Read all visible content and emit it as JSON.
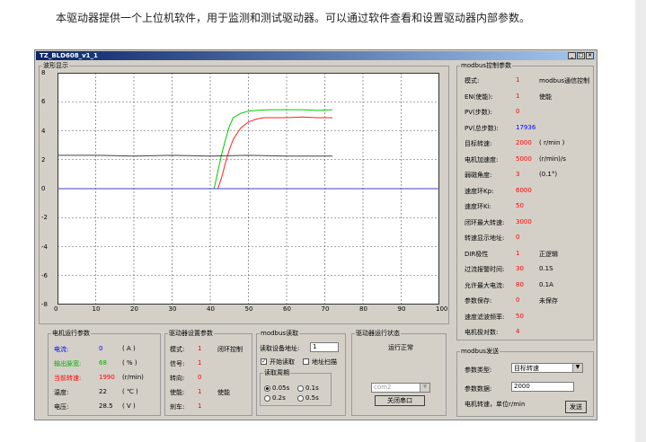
{
  "intro": "本驱动器提供一个上位机软件，用于监测和测试驱动器。可以通过软件查看和设置驱动器内部参数。",
  "window": {
    "title": "TZ_BLD608_v1_1"
  },
  "wave": {
    "legend": "波形显示",
    "chart_data": {
      "type": "line",
      "xlim": [
        0,
        100
      ],
      "ylim": [
        -8,
        8
      ],
      "x_ticks": [
        "0",
        "10",
        "20",
        "30",
        "40",
        "50",
        "60",
        "70",
        "80",
        "90",
        "100"
      ],
      "y_ticks": [
        "8",
        "6",
        "4",
        "2",
        "0",
        "-2",
        "-4",
        "-6",
        "-8"
      ],
      "grid": true,
      "series": [
        {
          "color": "#00cc00",
          "x": [
            0,
            40,
            41,
            42,
            43,
            44,
            45,
            46,
            48,
            50,
            52,
            56,
            60,
            64,
            68,
            72
          ],
          "y": [
            null,
            null,
            0,
            1.2,
            2.4,
            3.4,
            4.3,
            4.9,
            5.2,
            5.35,
            5.4,
            5.45,
            5.45,
            5.45,
            5.4,
            5.45
          ]
        },
        {
          "color": "#ff2020",
          "x": [
            0,
            41,
            42,
            43,
            44,
            45,
            46,
            48,
            50,
            52,
            54,
            56,
            60,
            64,
            68,
            72
          ],
          "y": [
            null,
            null,
            0,
            0.8,
            1.8,
            2.7,
            3.4,
            4.2,
            4.6,
            4.8,
            4.9,
            4.9,
            4.9,
            4.95,
            4.9,
            4.9
          ]
        },
        {
          "color": "#404040",
          "x": [
            0,
            10,
            20,
            30,
            40,
            50,
            60,
            72
          ],
          "y": [
            2.3,
            2.3,
            2.25,
            2.3,
            2.25,
            2.3,
            2.25,
            2.25
          ]
        },
        {
          "color": "#4040c0",
          "x": [
            0,
            100
          ],
          "y": [
            0,
            0
          ]
        }
      ]
    }
  },
  "motor": {
    "legend": "电机运行参数",
    "rows": [
      {
        "label": "电流:",
        "value": "0",
        "unit": "( A )",
        "color": "#0000ff"
      },
      {
        "label": "输出脉宽:",
        "value": "68",
        "unit": "( % )",
        "color": "#00b000"
      },
      {
        "label": "当前转速:",
        "value": "1990",
        "unit": "(r/min)",
        "color": "#ff0000"
      },
      {
        "label": "温度:",
        "value": "22",
        "unit": "( ℃ )",
        "color": "#000000"
      },
      {
        "label": "电压:",
        "value": "28.5",
        "unit": "( V )",
        "color": "#000000"
      }
    ]
  },
  "driver": {
    "legend": "驱动器设置参数",
    "rows": [
      {
        "label": "模式:",
        "value": "1",
        "note": "闭环控制"
      },
      {
        "label": "信号:",
        "value": "1",
        "note": ""
      },
      {
        "label": "转向:",
        "value": "0",
        "note": ""
      },
      {
        "label": "使能:",
        "value": "1",
        "note": "使能"
      },
      {
        "label": "刹车:",
        "value": "1",
        "note": ""
      }
    ]
  },
  "mbread": {
    "legend": "modbus读取",
    "addr_label": "读取设备地址:",
    "addr_value": "1",
    "start_label": "开始读取",
    "scan_label": "地址扫描",
    "period_legend": "读取周期",
    "periods": [
      "0.05s",
      "0.1s",
      "0.2s",
      "0.5s"
    ]
  },
  "status": {
    "legend": "驱动器运行状态",
    "text": "运行正常",
    "port": "com2",
    "close_btn": "关闭串口"
  },
  "ctrl": {
    "legend": "modbus控制参数",
    "rows": [
      {
        "label": "模式:",
        "value": "1",
        "note": "modbus通信控制",
        "color": "#ff0000"
      },
      {
        "label": "EN(使能):",
        "value": "1",
        "note": "使能",
        "color": "#ff0000"
      },
      {
        "label": "PV(步数):",
        "value": "0",
        "note": "",
        "color": "#ff0000"
      },
      {
        "label": "PV(总步数):",
        "value": "17936",
        "note": "",
        "color": "#0000ff"
      },
      {
        "label": "目标转速:",
        "value": "2000",
        "note": "( r/min )",
        "color": "#ff0000"
      },
      {
        "label": "电机加速度:",
        "value": "5000",
        "note": "(r/min)/s",
        "color": "#ff0000"
      },
      {
        "label": "弱磁角度:",
        "value": "3",
        "note": "(0.1°)",
        "color": "#ff0000"
      },
      {
        "label": "速度环Kp:",
        "value": "6000",
        "note": "",
        "color": "#ff0000"
      },
      {
        "label": "速度环Ki:",
        "value": "50",
        "note": "",
        "color": "#ff0000"
      },
      {
        "label": "闭环最大转速:",
        "value": "3000",
        "note": "",
        "color": "#ff0000"
      },
      {
        "label": "转速显示地址:",
        "value": "0",
        "note": "",
        "color": "#ff0000"
      },
      {
        "label": "DIR极性",
        "value": "1",
        "note": "正逻辑",
        "color": "#ff0000"
      },
      {
        "label": "过流报警时间:",
        "value": "30",
        "note": "0.1S",
        "color": "#ff0000"
      },
      {
        "label": "允许最大电流:",
        "value": "80",
        "note": "0.1A",
        "color": "#ff0000"
      },
      {
        "label": "参数保存:",
        "value": "0",
        "note": "未保存",
        "color": "#ff0000"
      },
      {
        "label": "速度滤波频率:",
        "value": "50",
        "note": "",
        "color": "#ff0000"
      },
      {
        "label": "电机极对数:",
        "value": "4",
        "note": "",
        "color": "#ff0000"
      }
    ]
  },
  "send": {
    "legend": "modbus发送",
    "type_label": "参数类型:",
    "type_value": "目标转速",
    "data_label": "参数数据:",
    "data_value": "2000",
    "hint": "电机转速，单位r/min",
    "send_btn": "发送"
  }
}
